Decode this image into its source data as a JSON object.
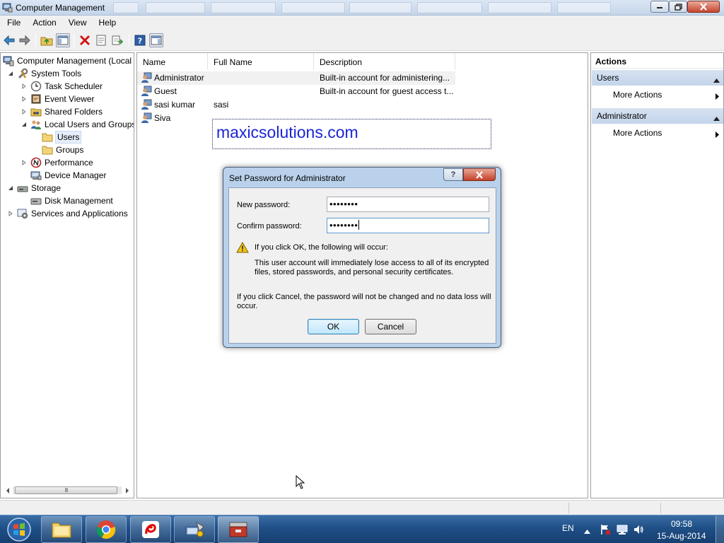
{
  "window": {
    "title": "Computer Management",
    "icon": "computer-management-icon"
  },
  "menu": [
    "File",
    "Action",
    "View",
    "Help"
  ],
  "toolbar": {
    "buttons": [
      "back-arrow-icon",
      "forward-arrow-icon",
      "up-folder-icon",
      "show-hide-console-tree-icon",
      "delete-icon",
      "properties-icon",
      "export-list-icon",
      "help-icon",
      "show-hide-action-pane-icon"
    ]
  },
  "tree": {
    "root": "Computer Management (Local",
    "system_tools": "System Tools",
    "task_scheduler": "Task Scheduler",
    "event_viewer": "Event Viewer",
    "shared_folders": "Shared Folders",
    "local_users_groups": "Local Users and Groups",
    "users": "Users",
    "groups": "Groups",
    "performance": "Performance",
    "device_manager": "Device Manager",
    "storage": "Storage",
    "disk_management": "Disk Management",
    "services_apps": "Services and Applications",
    "scroll_grip": "III"
  },
  "list": {
    "columns": [
      "Name",
      "Full Name",
      "Description"
    ],
    "rows": [
      {
        "name": "Administrator",
        "full_name": "",
        "description": "Built-in account for administering..."
      },
      {
        "name": "Guest",
        "full_name": "",
        "description": "Built-in account for guest access t..."
      },
      {
        "name": "sasi kumar",
        "full_name": "sasi",
        "description": ""
      },
      {
        "name": "Siva",
        "full_name": "",
        "description": ""
      }
    ],
    "watermark": "maxicsolutions.com"
  },
  "actions": {
    "header": "Actions",
    "sections": [
      {
        "title": "Users",
        "item": "More Actions"
      },
      {
        "title": "Administrator",
        "item": "More Actions"
      }
    ]
  },
  "dialog": {
    "title": "Set Password for Administrator",
    "help_glyph": "?",
    "new_password_label": "New password:",
    "new_password_value": "••••••••",
    "confirm_password_label": "Confirm password:",
    "confirm_password_value": "••••••••",
    "warning_heading": "If you click OK, the following will occur:",
    "warning_body_1": "This user account will immediately lose access to all of its encrypted",
    "warning_body_2": "files, stored passwords, and personal security certificates.",
    "cancel_note_1": "If you click Cancel, the password will not be changed and no data loss will",
    "cancel_note_2": "occur.",
    "ok_label": "OK",
    "cancel_label": "Cancel"
  },
  "taskbar": {
    "apps": [
      "windows-explorer-icon",
      "chrome-icon",
      "airtel-icon",
      "network-tool-icon",
      "computer-management-icon"
    ],
    "language": "EN",
    "time": "09:58",
    "date": "15-Aug-2014"
  },
  "colors": {
    "selection": "#e5eefa",
    "action_section": "#c9d9ee",
    "dialog_frame": "#b9d1ea",
    "watermark": "#1a25d6",
    "taskbar": "#1f4f86"
  }
}
